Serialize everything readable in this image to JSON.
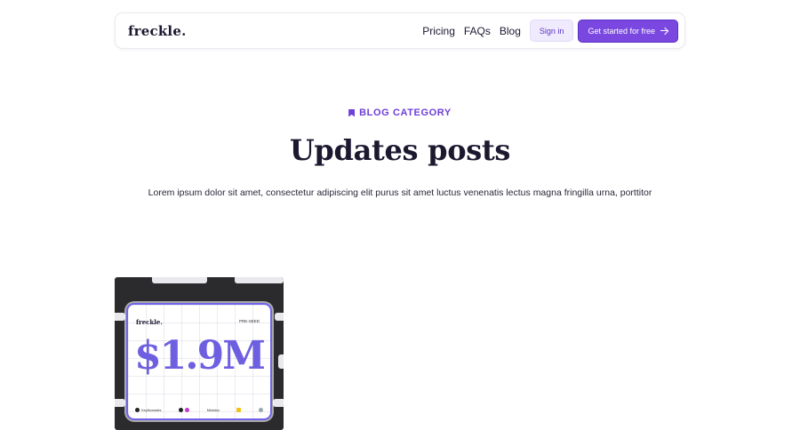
{
  "nav": {
    "logo": "freckle.",
    "links": [
      "Pricing",
      "FAQs",
      "Blog"
    ],
    "signin_label": "Sign in",
    "cta_label": "Get started for free"
  },
  "hero": {
    "category": "BLOG CATEGORY",
    "title": "Updates posts",
    "subtitle": "Lorem ipsum dolor sit amet, consectetur adipiscing elit purus sit amet luctus venenatis lectus magna fringilla urna, porttitor"
  },
  "card": {
    "logo": "freckle.",
    "badge": "PRE-SEED",
    "amount": "$1.9M",
    "partner_logos": [
      "Keyflowstats",
      "Mintaka"
    ]
  },
  "colors": {
    "accent": "#7a48e0",
    "accent_light": "#efeafc",
    "card_amount": "#6d5fe0"
  }
}
